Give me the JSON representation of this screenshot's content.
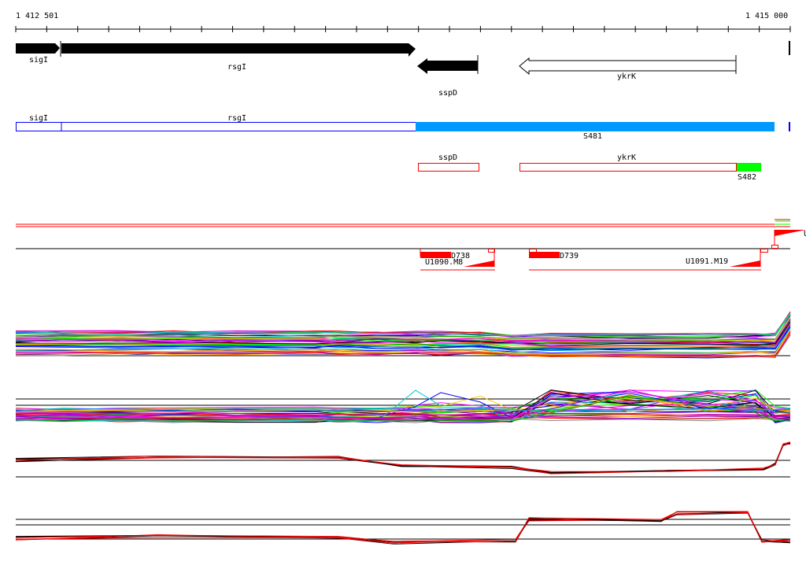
{
  "ruler": {
    "start_label": "1 412 501",
    "end_label": "1 415 000",
    "start": 1412501,
    "end": 1415000
  },
  "genes": [
    {
      "name": "sigI",
      "strand": "+",
      "style": "filled"
    },
    {
      "name": "rsgI",
      "strand": "+",
      "style": "filled"
    },
    {
      "name": "sspD",
      "strand": "-",
      "style": "filled"
    },
    {
      "name": "ykrK",
      "strand": "-",
      "style": "open"
    }
  ],
  "segments_row1": {
    "labels": [
      "sigI",
      "rsgI"
    ],
    "segment": "S481",
    "colors": {
      "outline": "#0000ff",
      "fill": "#0099ff"
    }
  },
  "segments_row2": {
    "labels": [
      "sspD",
      "ykrK"
    ],
    "segment": "S482",
    "colors": {
      "outline": "#ff0000",
      "fill": "#00ff00"
    }
  },
  "features": {
    "labels": [
      "D738",
      "U1090.M8",
      "D739",
      "U1091.M19",
      "U"
    ],
    "color": "#ff0000"
  },
  "colors": {
    "red": "#ff0000",
    "green": "#00ff00",
    "black": "#000000"
  }
}
